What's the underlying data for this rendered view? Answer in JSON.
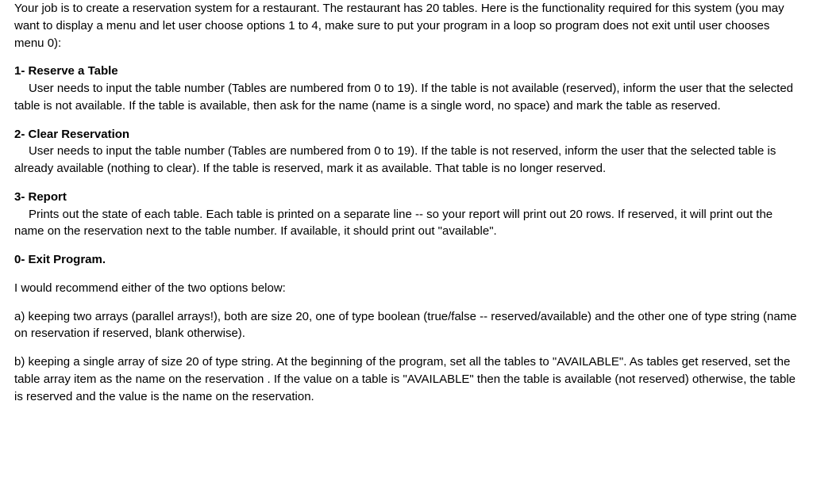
{
  "intro": "Your job is to create a reservation system for a restaurant. The restaurant has 20 tables. Here is the functionality required for this system (you may want to display a menu and let user choose options 1 to 4, make sure to put your program in a loop so program does not exit until user chooses menu 0):",
  "sections": {
    "s1": {
      "heading": "1- Reserve a Table",
      "body": "User needs to input the table number (Tables are numbered from 0 to 19). If the table is not available (reserved), inform the user that the selected table is not available. If the table is available, then ask for the name (name is a single word, no space) and mark the table as reserved."
    },
    "s2": {
      "heading": "2- Clear Reservation",
      "body": "User needs to input the table number (Tables are numbered from 0 to 19). If the table is not reserved, inform the user that the selected table is already available (nothing to clear). If the table is reserved, mark it as available. That table is no longer reserved."
    },
    "s3": {
      "heading": "3- Report",
      "body": "Prints out the state of each table. Each table is printed on a separate line -- so your report will print out 20 rows. If reserved, it will print out the name on the reservation next to the table number. If available, it should print out \"available\"."
    },
    "s0": {
      "heading": "0- Exit Program."
    }
  },
  "recommend_intro": "I would recommend either of the two options below:",
  "option_a": "a) keeping two arrays (parallel arrays!), both are size 20, one of type boolean (true/false -- reserved/available) and the other one of type string (name on reservation if reserved, blank otherwise).",
  "option_b": "b) keeping a single array of size 20 of type string. At the beginning of the program, set all the tables to \"AVAILABLE\". As tables get reserved, set the table array item as the name on the reservation .  If the value on a table is \"AVAILABLE\" then the table is available (not reserved) otherwise, the table is reserved and the value is the name on the reservation."
}
